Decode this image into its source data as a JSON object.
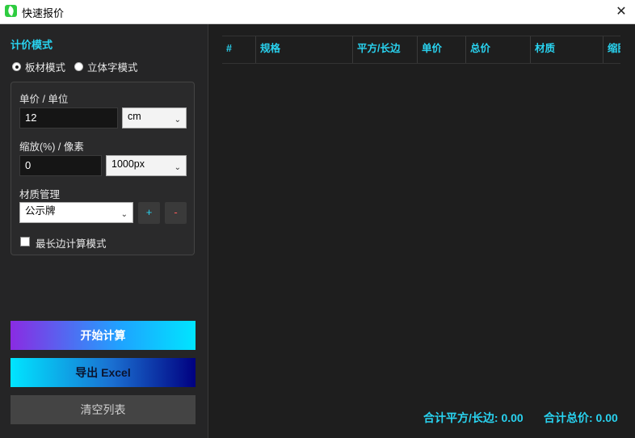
{
  "window": {
    "title": "快速报价",
    "close_glyph": "✕"
  },
  "pricing": {
    "section_title": "计价模式",
    "modes": [
      {
        "label": "板材模式",
        "checked": true
      },
      {
        "label": "立体字模式",
        "checked": false
      }
    ],
    "unit_price_label": "单价 / 单位",
    "unit_price_value": "12",
    "unit_select": "cm",
    "scale_label": "缩放(%) / 像素",
    "scale_value": "0",
    "pixel_select": "1000px",
    "material_label": "材质管理",
    "material_select": "公示牌",
    "add_label": "+",
    "remove_label": "-",
    "longest_side_label": "最长边计算模式",
    "longest_side_checked": false
  },
  "actions": {
    "start_label": "开始计算",
    "export_label": "导出 Excel",
    "clear_label": "清空列表"
  },
  "table": {
    "columns": [
      "#",
      "规格",
      "平方/长边",
      "单价",
      "总价",
      "材质",
      "缩图"
    ]
  },
  "totals": {
    "area_label": "合计平方/长边: 0.00",
    "price_label": "合计总价: 0.00"
  },
  "colors": {
    "accent": "#29d3f0",
    "panel": "#252526",
    "background": "#1e1e1e"
  }
}
